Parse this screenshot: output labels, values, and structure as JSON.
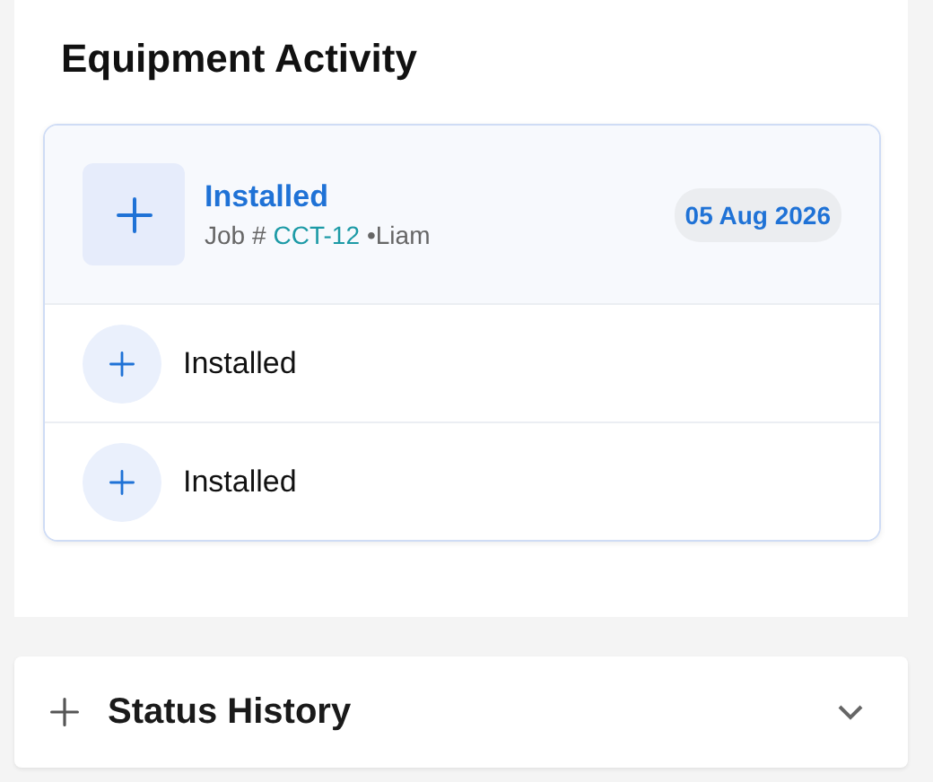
{
  "activity": {
    "title": "Equipment Activity",
    "items": [
      {
        "label": "Installed",
        "expanded": true,
        "job_prefix": "Job #",
        "job": "CCT-12",
        "user": "•Liam",
        "date": "05 Aug 2026"
      },
      {
        "label": "Installed",
        "expanded": false
      },
      {
        "label": "Installed",
        "expanded": false
      }
    ]
  },
  "status_history": {
    "title": "Status History",
    "expanded": false
  }
}
